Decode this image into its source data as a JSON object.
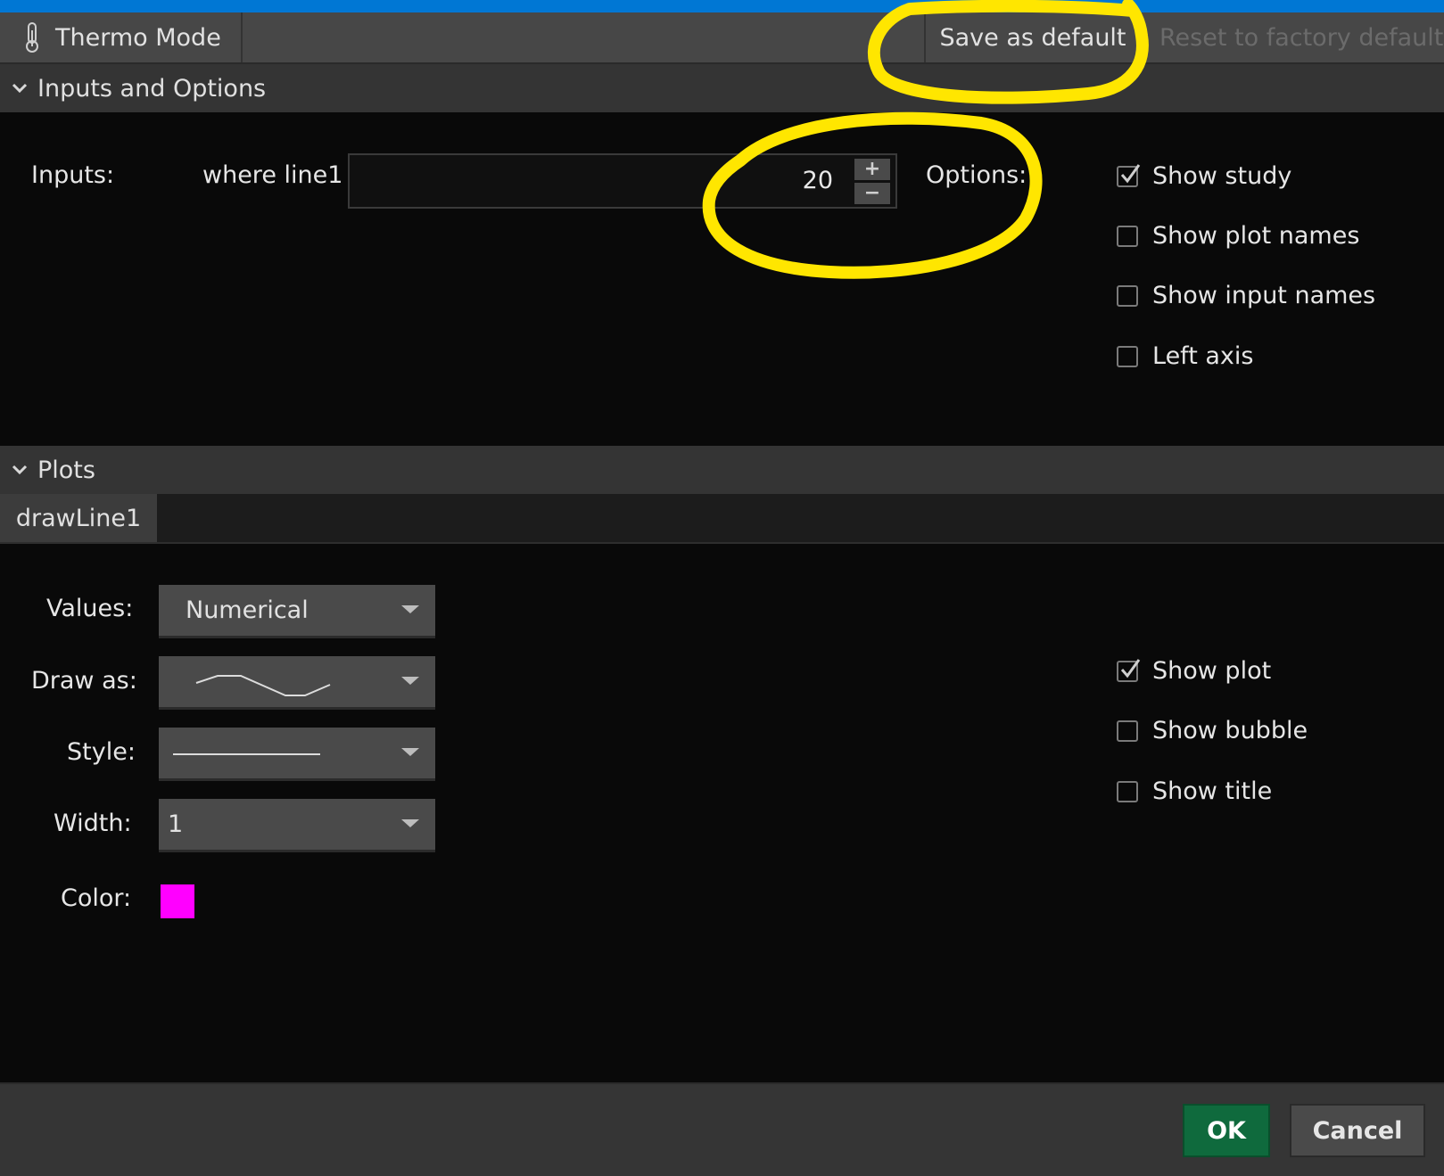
{
  "toolbar": {
    "thermo_label": "Thermo Mode",
    "save_default_label": "Save as default",
    "reset_default_label": "Reset to factory default"
  },
  "sections": {
    "inputs_header": "Inputs and Options",
    "plots_header": "Plots"
  },
  "inputs": {
    "label": "Inputs:",
    "field_label": "where line1",
    "field_value": "20",
    "step_up": "+",
    "step_down": "−"
  },
  "options": {
    "label": "Options:",
    "items": [
      {
        "label": "Show study",
        "checked": true
      },
      {
        "label": "Show plot names",
        "checked": false
      },
      {
        "label": "Show input names",
        "checked": false
      },
      {
        "label": "Left axis",
        "checked": false
      }
    ]
  },
  "plots": {
    "tab_label": "drawLine1",
    "values_label": "Values:",
    "values_selected": "Numerical",
    "draw_as_label": "Draw as:",
    "style_label": "Style:",
    "width_label": "Width:",
    "width_selected": "1",
    "color_label": "Color:",
    "color_value": "#ff00ff",
    "checks": [
      {
        "label": "Show plot",
        "checked": true
      },
      {
        "label": "Show bubble",
        "checked": false
      },
      {
        "label": "Show title",
        "checked": false
      }
    ]
  },
  "footer": {
    "ok_label": "OK",
    "cancel_label": "Cancel"
  },
  "colors": {
    "window_accent": "#0077d4",
    "ok_button": "#0f6a3d",
    "annotation": "#ffe600"
  }
}
